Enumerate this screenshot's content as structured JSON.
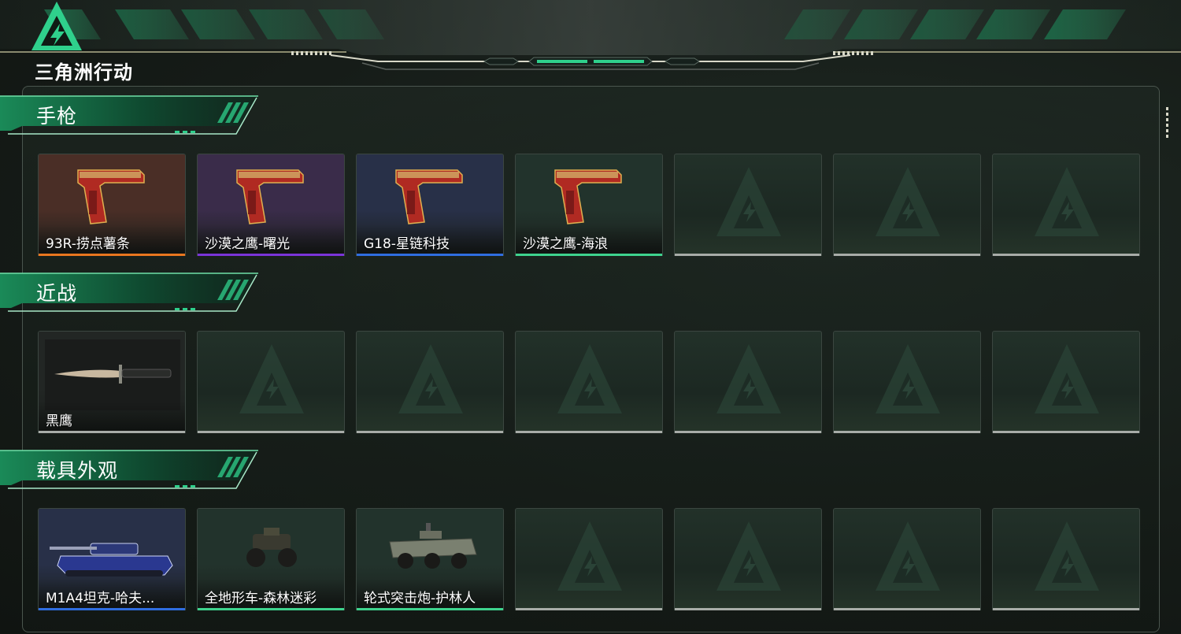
{
  "app": {
    "logo_text": "三角洲行动"
  },
  "sections": [
    {
      "title": "手枪",
      "items": [
        {
          "label": "93R-捞点薯条",
          "rarity_color": "#e8761f",
          "bg": "#4a2e26",
          "icon": "pistol-icon"
        },
        {
          "label": "沙漠之鹰-曙光",
          "rarity_color": "#7a34d8",
          "bg": "#3a2c4a",
          "icon": "pistol-icon"
        },
        {
          "label": "G18-星链科技",
          "rarity_color": "#2f6de0",
          "bg": "#283048",
          "icon": "pistol-icon"
        },
        {
          "label": "沙漠之鹰-海浪",
          "rarity_color": "#3ed38e",
          "bg": "#22332c",
          "icon": "pistol-icon"
        },
        {
          "label": "",
          "rarity_color": "#a8aca8",
          "icon": "empty-slot-logo-icon"
        },
        {
          "label": "",
          "rarity_color": "#a8aca8",
          "icon": "empty-slot-logo-icon"
        },
        {
          "label": "",
          "rarity_color": "#a8aca8",
          "icon": "empty-slot-logo-icon"
        }
      ]
    },
    {
      "title": "近战",
      "items": [
        {
          "label": "黑鹰",
          "rarity_color": "#a8aca8",
          "bg": "#222624",
          "icon": "knife-icon"
        },
        {
          "label": "",
          "rarity_color": "#a8aca8",
          "icon": "empty-slot-logo-icon"
        },
        {
          "label": "",
          "rarity_color": "#a8aca8",
          "icon": "empty-slot-logo-icon"
        },
        {
          "label": "",
          "rarity_color": "#a8aca8",
          "icon": "empty-slot-logo-icon"
        },
        {
          "label": "",
          "rarity_color": "#a8aca8",
          "icon": "empty-slot-logo-icon"
        },
        {
          "label": "",
          "rarity_color": "#a8aca8",
          "icon": "empty-slot-logo-icon"
        },
        {
          "label": "",
          "rarity_color": "#a8aca8",
          "icon": "empty-slot-logo-icon"
        }
      ]
    },
    {
      "title": "载具外观",
      "items": [
        {
          "label": "M1A4坦克-哈夫...",
          "rarity_color": "#2f6de0",
          "bg": "#283048",
          "icon": "tank-icon"
        },
        {
          "label": "全地形车-森林迷彩",
          "rarity_color": "#3ed38e",
          "bg": "#22332c",
          "icon": "atv-icon"
        },
        {
          "label": "轮式突击炮-护林人",
          "rarity_color": "#3ed38e",
          "bg": "#22332c",
          "icon": "armored-vehicle-icon"
        },
        {
          "label": "",
          "rarity_color": "#a8aca8",
          "icon": "empty-slot-logo-icon"
        },
        {
          "label": "",
          "rarity_color": "#a8aca8",
          "icon": "empty-slot-logo-icon"
        },
        {
          "label": "",
          "rarity_color": "#a8aca8",
          "icon": "empty-slot-logo-icon"
        },
        {
          "label": "",
          "rarity_color": "#a8aca8",
          "icon": "empty-slot-logo-icon"
        }
      ]
    }
  ],
  "colors": {
    "accent": "#2fd08c",
    "panel_border": "#4a554e"
  }
}
